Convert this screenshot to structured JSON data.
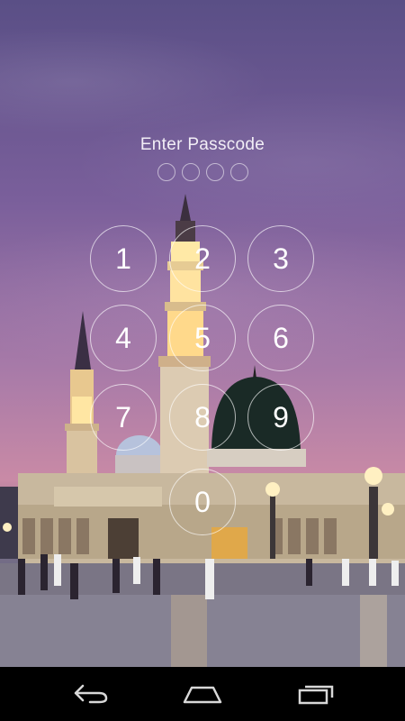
{
  "lockscreen": {
    "title": "Enter Passcode",
    "passcode_length": 4,
    "entered_digits": 0,
    "keys": [
      "1",
      "2",
      "3",
      "4",
      "5",
      "6",
      "7",
      "8",
      "9",
      "0"
    ]
  },
  "navbar": {
    "buttons": [
      "back-icon",
      "home-icon",
      "recent-apps-icon"
    ]
  },
  "colors": {
    "sky_top": "#5a4f86",
    "sky_mid": "#a77aa8",
    "navbar": "#000000",
    "key_border": "#ffffff"
  }
}
